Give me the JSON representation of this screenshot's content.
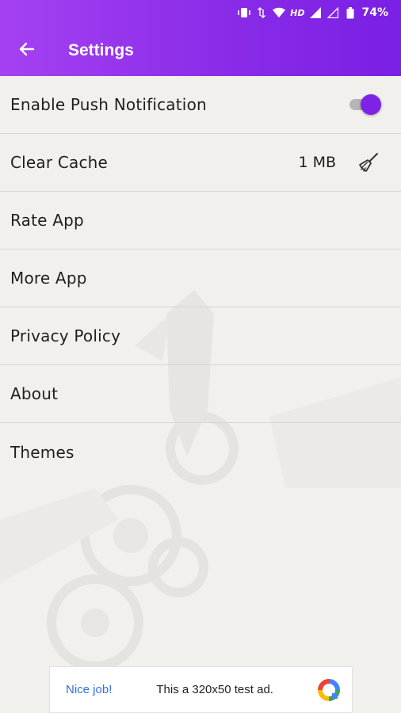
{
  "status_bar": {
    "hd_label": "HD",
    "battery": "74%",
    "icons": [
      "vibrate-icon",
      "data-arrows-icon",
      "wifi-icon",
      "signal-icon",
      "signal-empty-icon",
      "battery-icon"
    ]
  },
  "header": {
    "title": "Settings",
    "back_icon": "arrow-left-icon",
    "accent_color": "#8a2ce8"
  },
  "settings": {
    "push_label": "Enable Push Notification",
    "push_enabled": true,
    "clear_cache_label": "Clear Cache",
    "cache_size": "1 MB",
    "cache_icon": "broom-icon",
    "rate_label": "Rate App",
    "more_label": "More App",
    "privacy_label": "Privacy Policy",
    "about_label": "About",
    "themes_label": "Themes"
  },
  "ad": {
    "nice": "Nice job!",
    "text": "This a 320x50 test ad."
  }
}
